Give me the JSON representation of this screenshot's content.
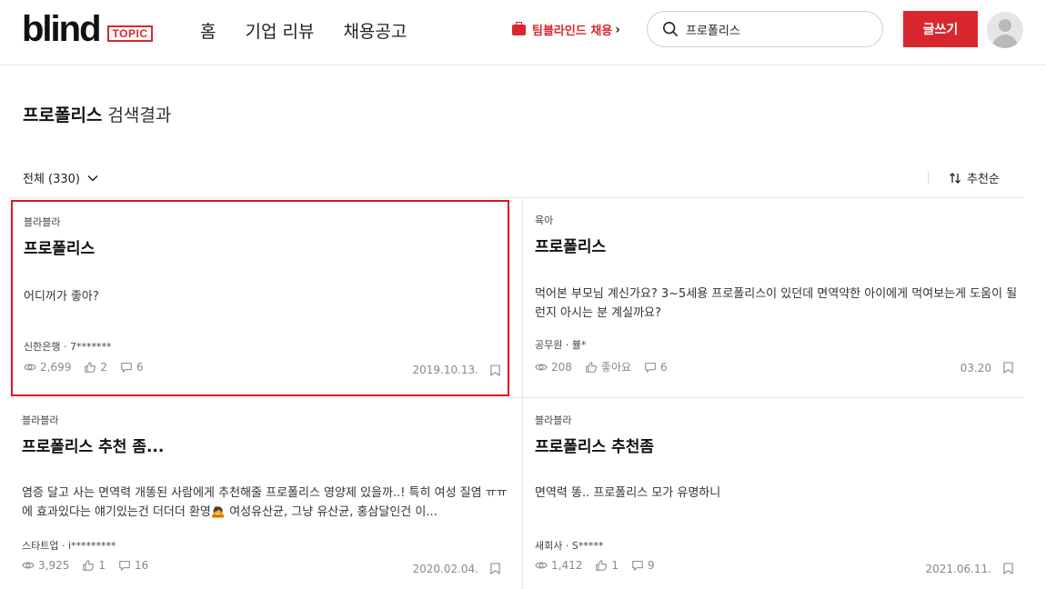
{
  "header": {
    "logo_word": "blind",
    "logo_badge": "TOPIC",
    "nav": [
      "홈",
      "기업 리뷰",
      "채용공고"
    ],
    "recruit_label": "팀블라인드 채용",
    "search_value": "프로폴리스",
    "write_label": "글쓰기"
  },
  "results": {
    "keyword": "프로폴리스",
    "suffix": " 검색결과",
    "filter_label": "전체 (330)",
    "sort_label": "추천순"
  },
  "posts": [
    {
      "category": "블라블라",
      "title": "프로폴리스",
      "excerpt": "어디꺼가 좋아?",
      "author": "신한은행 · 7*******",
      "views": "2,699",
      "likes": "2",
      "comments": "6",
      "date": "2019.10.13."
    },
    {
      "category": "육아",
      "title": "프로폴리스",
      "excerpt": "먹어본 부모님 계신가요? 3~5세용 프로폴리스이 있던데 면역약한 아이에게 먹여보는게 도움이 될런지 아시는 분 계실까요?",
      "author": "공무원 · 뷸*",
      "views": "208",
      "likes": "좋아요",
      "comments": "6",
      "date": "03.20"
    },
    {
      "category": "블라블라",
      "title": "프로폴리스 추천 좀...",
      "excerpt": "염증 달고 사는 면역력 개똥된 사람에게 추천해줄 프로폴리스 영양제 있을까..! 특히 여성 질염 ㅠㅠ에 효과있다는 얘기있는건 더더더 환영🙇 여성유산균, 그냥 유산균, 홍삼달인건 이...",
      "author": "스타트업 · i*********",
      "views": "3,925",
      "likes": "1",
      "comments": "16",
      "date": "2020.02.04."
    },
    {
      "category": "블라블라",
      "title": "프로폴리스 추천좀",
      "excerpt": "면역력 똥.. 프로폴리스 모가 유명하니",
      "author": "새회사 · S*****",
      "views": "1,412",
      "likes": "1",
      "comments": "9",
      "date": "2021.06.11."
    }
  ],
  "colors": {
    "brand_red": "#d9272e",
    "highlight_border": "#e0141e"
  }
}
